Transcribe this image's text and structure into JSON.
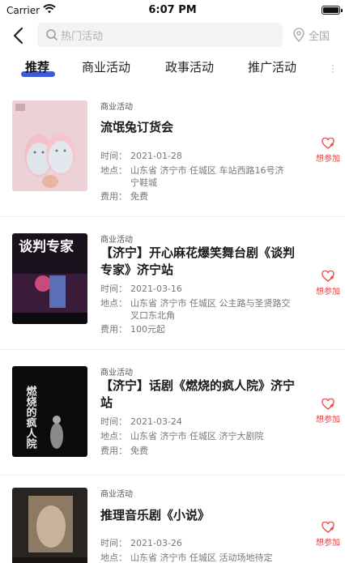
{
  "status": {
    "carrier": "Carrier",
    "time": "6:07 PM"
  },
  "nav": {
    "search_placeholder": "热门活动",
    "location": "全国"
  },
  "tabs": [
    {
      "label": "推荐",
      "active": true
    },
    {
      "label": "商业活动"
    },
    {
      "label": "政事活动"
    },
    {
      "label": "推广活动"
    }
  ],
  "labels": {
    "time": "时间：",
    "address": "地点：",
    "fee": "费用：",
    "want": "想参加"
  },
  "colors": {
    "accent": "#3d5bd9",
    "want": "#e4453f"
  },
  "events": [
    {
      "tag": "商业活动",
      "title": "流氓兔订货会",
      "time": "2021-01-28",
      "address": "山东省 济宁市 任城区 车站西路16号济宁鞋城",
      "fee": "免费",
      "image": "pink-slippers-photo"
    },
    {
      "tag": "商业活动",
      "title": "【济宁】开心麻花爆笑舞台剧《谈判专家》济宁站",
      "time": "2021-03-16",
      "address": "山东省 济宁市 任城区 公主路与圣贤路交叉口东北角",
      "fee": "100元起",
      "image": "negotiator-poster",
      "poster_text": "谈判专家"
    },
    {
      "tag": "商业活动",
      "title": "【济宁】话剧《燃烧的疯人院》济宁站",
      "time": "2021-03-24",
      "address": "山东省 济宁市 任城区 济宁大剧院",
      "fee": "免费",
      "image": "burning-asylum-poster",
      "poster_text": "燃烧的疯人院"
    },
    {
      "tag": "商业活动",
      "title": "推理音乐剧《小说》",
      "time": "2021-03-26",
      "address": "山东省 济宁市 任城区 活动场地待定",
      "fee": "",
      "image": "novel-musical-poster"
    }
  ]
}
